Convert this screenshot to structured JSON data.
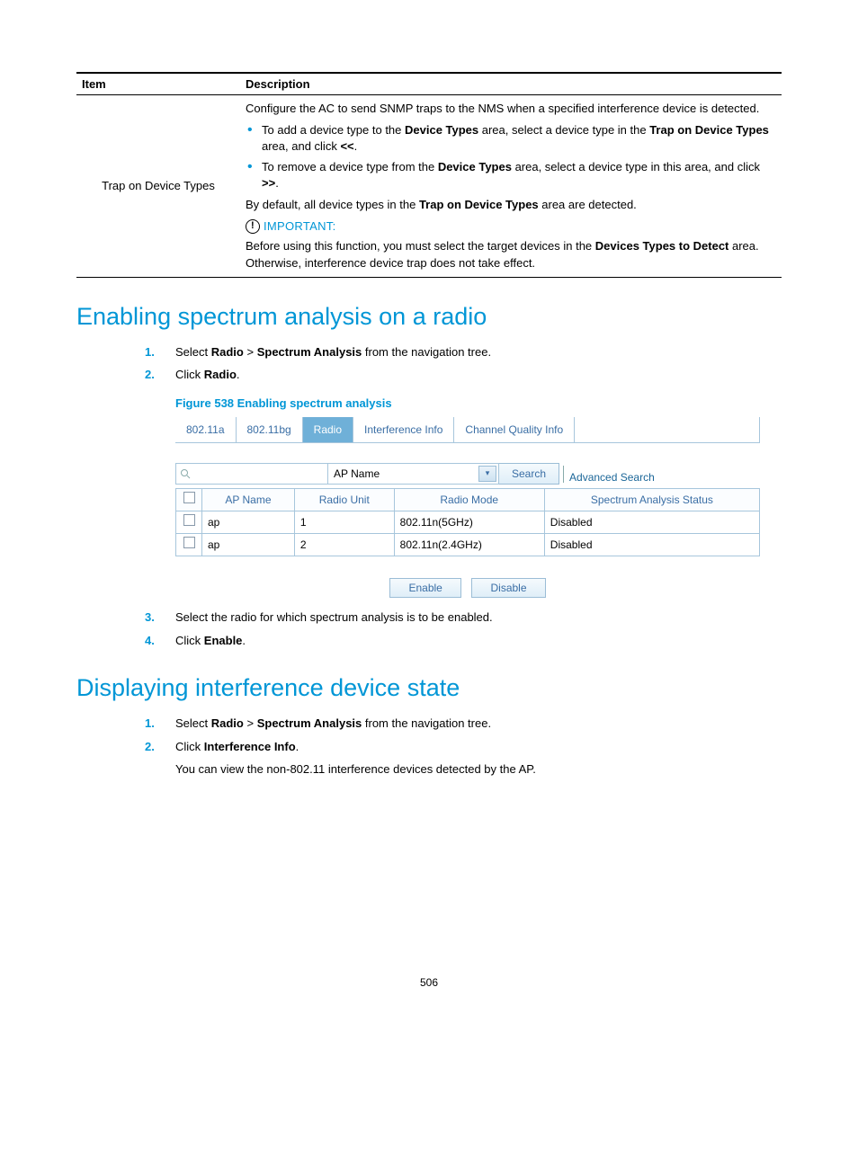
{
  "defTable": {
    "header": {
      "item": "Item",
      "desc": "Description"
    },
    "row": {
      "item": "Trap on Device Types",
      "intro": "Configure the AC to send SNMP traps to the NMS when a specified interference device is detected.",
      "bullet1a": "To add a device type to the ",
      "bullet1b": "Device Types",
      "bullet1c": " area, select a device type in the ",
      "bullet1d": "Trap on Device Types",
      "bullet1e": " area, and click ",
      "bullet1f": "<<",
      "bullet1g": ".",
      "bullet2a": "To remove a device type from the ",
      "bullet2b": "Device Types",
      "bullet2c": " area, select a device type in this area, and click ",
      "bullet2d": ">>",
      "bullet2e": ".",
      "defaulta": "By default, all device types in the ",
      "defaultb": "Trap on Device Types",
      "defaultc": " area are detected.",
      "important": "IMPORTANT:",
      "note1a": "Before using this function, you must select the target devices in the ",
      "note1b": "Devices Types to Detect",
      "note1c": " area. Otherwise, interference device trap does not take effect."
    }
  },
  "section1": {
    "title": "Enabling spectrum analysis on a radio",
    "step1a": "Select ",
    "step1b": "Radio",
    "step1c": " > ",
    "step1d": "Spectrum Analysis",
    "step1e": " from the navigation tree.",
    "step2a": "Click ",
    "step2b": "Radio",
    "step2c": ".",
    "figcap": "Figure 538 Enabling spectrum analysis",
    "tabs": [
      "802.11a",
      "802.11bg",
      "Radio",
      "Interference Info",
      "Channel Quality Info"
    ],
    "search": {
      "dropdown": "AP Name",
      "button": "Search",
      "adv": "Advanced Search"
    },
    "cols": [
      "AP Name",
      "Radio Unit",
      "Radio Mode",
      "Spectrum Analysis Status"
    ],
    "rows": [
      {
        "ap": "ap",
        "unit": "1",
        "mode": "802.11n(5GHz)",
        "status": "Disabled"
      },
      {
        "ap": "ap",
        "unit": "2",
        "mode": "802.11n(2.4GHz)",
        "status": "Disabled"
      }
    ],
    "enable": "Enable",
    "disable": "Disable",
    "step3": "Select the radio for which spectrum analysis is to be enabled.",
    "step4a": "Click ",
    "step4b": "Enable",
    "step4c": "."
  },
  "section2": {
    "title": "Displaying interference device state",
    "step1a": "Select ",
    "step1b": "Radio",
    "step1c": " > ",
    "step1d": "Spectrum Analysis",
    "step1e": " from the navigation tree.",
    "step2a": "Click ",
    "step2b": "Interference Info",
    "step2c": ".",
    "note": "You can view the non-802.11 interference devices detected by the AP."
  },
  "pageNumber": "506"
}
